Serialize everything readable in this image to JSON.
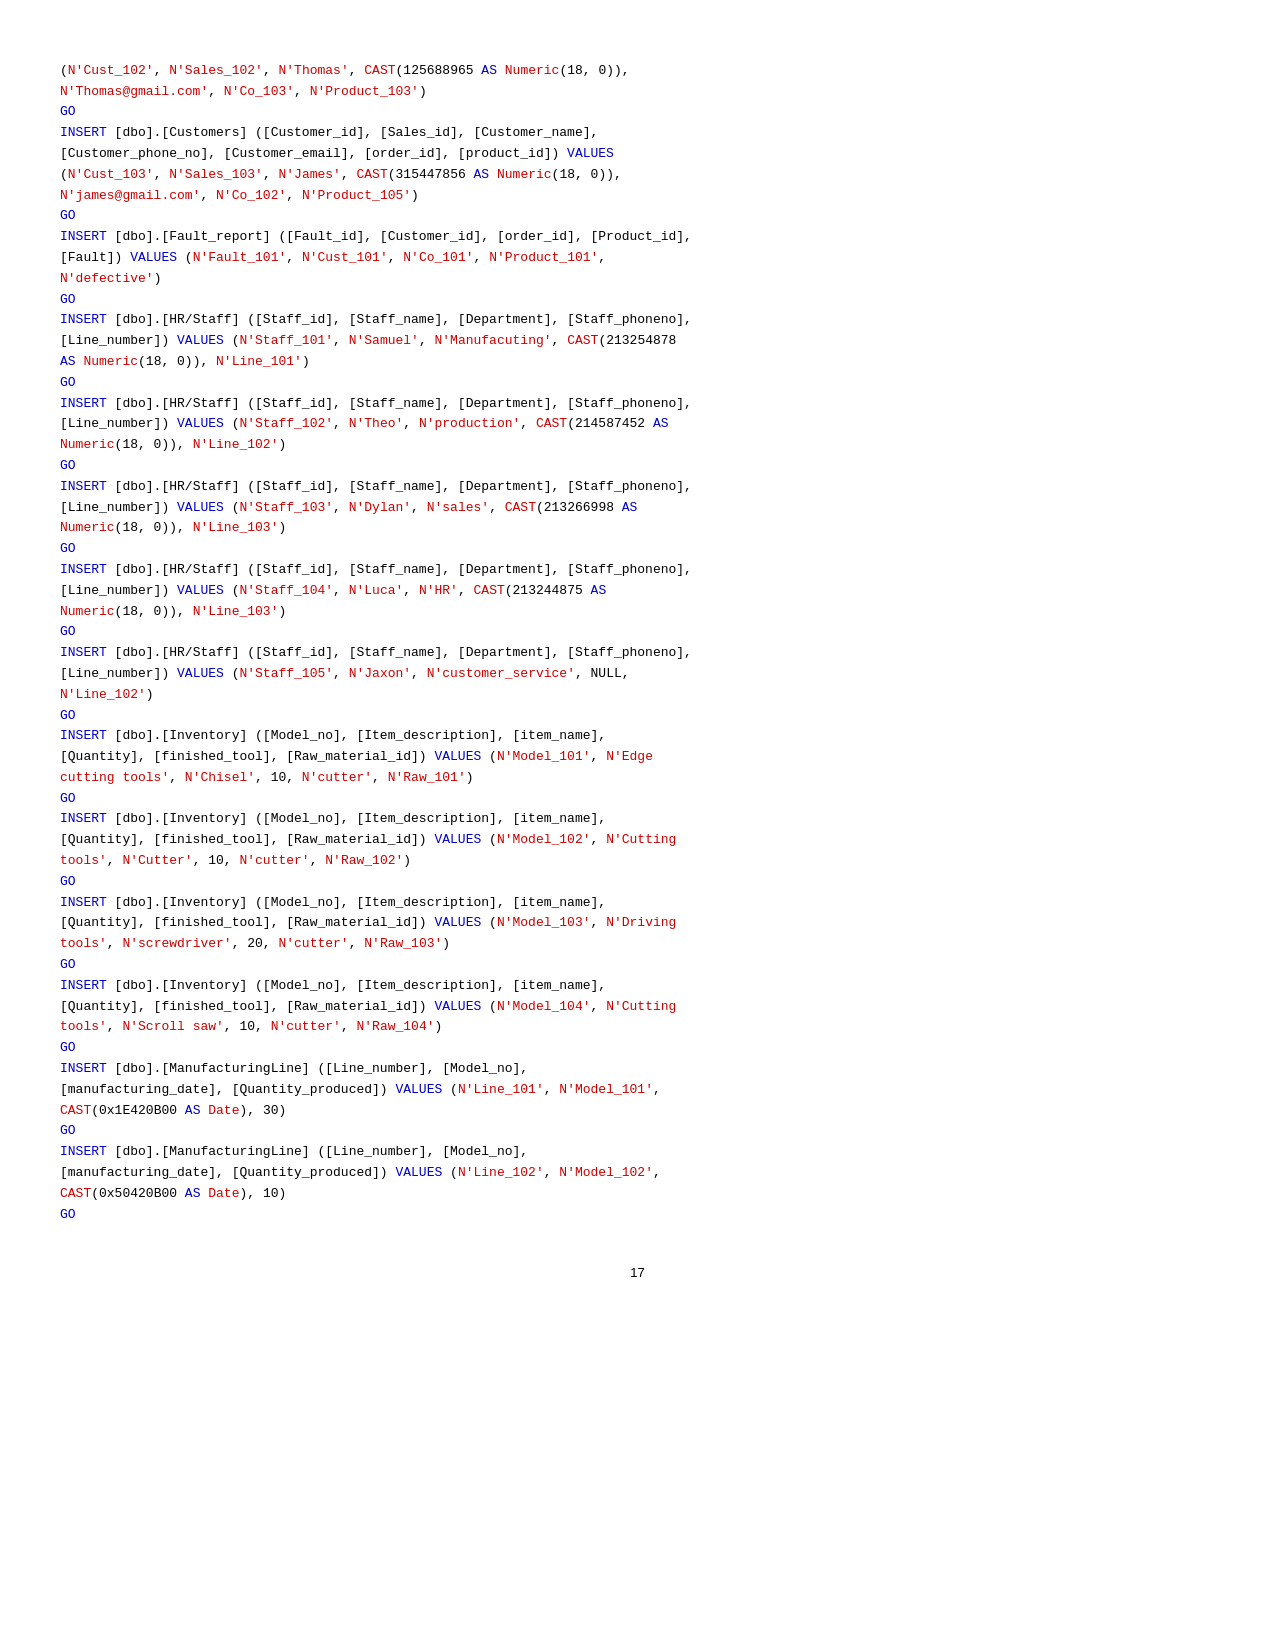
{
  "page": {
    "number": "17",
    "content_lines": []
  }
}
